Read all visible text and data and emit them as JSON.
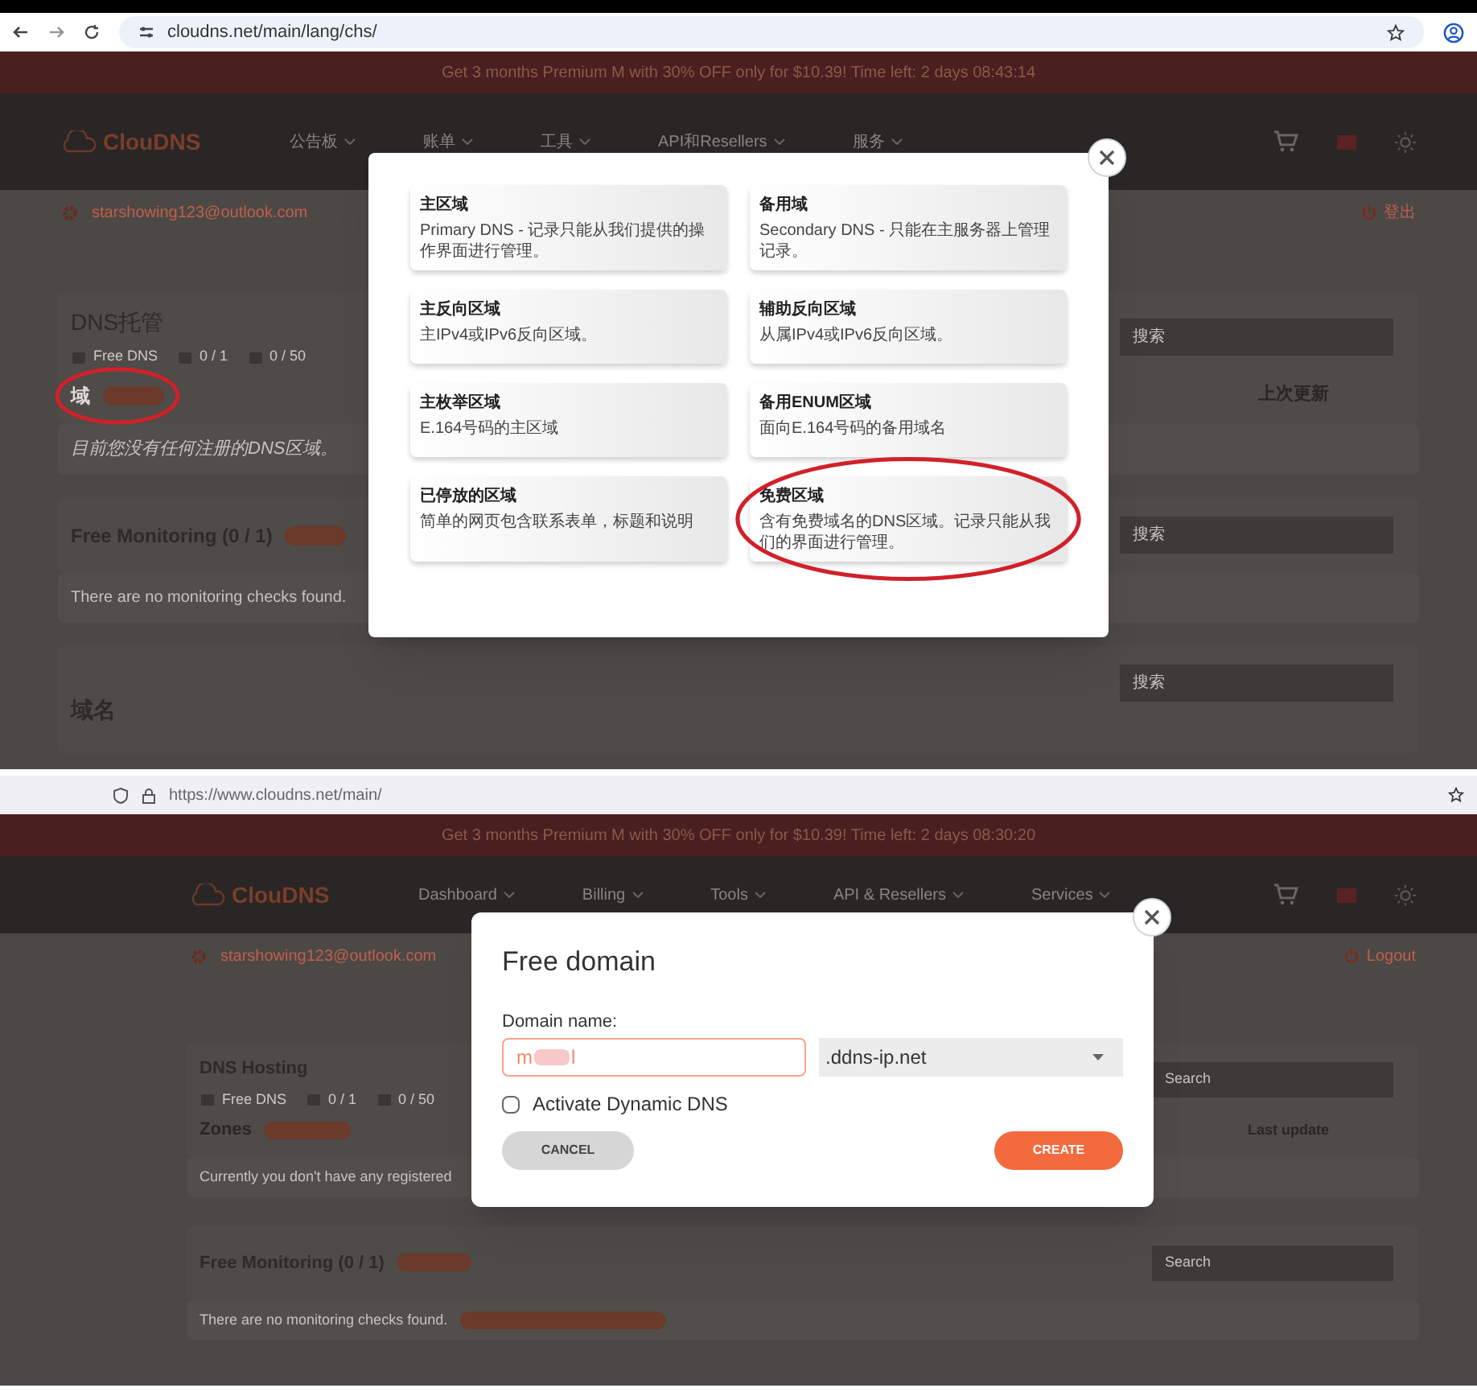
{
  "top": {
    "browser": {
      "url": "cloudns.net/main/lang/chs/"
    },
    "promo": "Get 3 months Premium M with 30% OFF only for $10.39! Time left: 2 days 08:43:14",
    "nav": {
      "logo": "ClouDNS",
      "items": [
        "公告板",
        "账单",
        "工具",
        "API和Resellers",
        "服务"
      ]
    },
    "user": {
      "email": "starshowing123@outlook.com",
      "logout": "登出"
    },
    "dns": {
      "title": "DNS托管",
      "stats": [
        "Free DNS",
        "0 / 1",
        "0 / 50"
      ],
      "zones_label": "域",
      "last_update": "上次更新",
      "search": "搜索",
      "empty": "目前您没有任何注册的DNS区域。"
    },
    "monitoring": {
      "title": "Free Monitoring (0 / 1)",
      "search": "搜索",
      "empty": "There are no monitoring checks found."
    },
    "domains": {
      "title": "域名",
      "search": "搜索"
    },
    "modal": {
      "cards": [
        {
          "title": "主区域",
          "description": "Primary DNS - 记录只能从我们提供的操作界面进行管理。",
          "circled": false
        },
        {
          "title": "备用域",
          "description": "Secondary DNS - 只能在主服务器上管理记录。",
          "circled": false
        },
        {
          "title": "主反向区域",
          "description": "主IPv4或IPv6反向区域。",
          "circled": false
        },
        {
          "title": "辅助反向区域",
          "description": "从属IPv4或IPv6反向区域。",
          "circled": false
        },
        {
          "title": "主枚举区域",
          "description": "E.164号码的主区域",
          "circled": false
        },
        {
          "title": "备用ENUM区域",
          "description": "面向E.164号码的备用域名",
          "circled": false
        },
        {
          "title": "已停放的区域",
          "description": "简单的网页包含联系表单，标题和说明",
          "circled": false
        },
        {
          "title": "免费区域",
          "description": "含有免费域名的DNS区域。记录只能从我们的界面进行管理。",
          "circled": true
        }
      ]
    }
  },
  "bottom": {
    "browser": {
      "url": "https://www.cloudns.net/main/"
    },
    "promo": "Get 3 months Premium M with 30% OFF only for $10.39! Time left: 2 days 08:30:20",
    "nav": {
      "logo": "ClouDNS",
      "items": [
        "Dashboard",
        "Billing",
        "Tools",
        "API & Resellers",
        "Services"
      ]
    },
    "user": {
      "email": "starshowing123@outlook.com",
      "logout": "Logout"
    },
    "dns": {
      "title": "DNS Hosting",
      "stats": [
        "Free DNS",
        "0 / 1",
        "0 / 50"
      ],
      "zones_label": "Zones",
      "last_update": "Last update",
      "search": "Search",
      "empty": "Currently you don't have any registered"
    },
    "monitoring": {
      "title": "Free Monitoring (0 / 1)",
      "search": "Search",
      "empty": "There are no monitoring checks found."
    },
    "modal": {
      "title": "Free domain",
      "label": "Domain name:",
      "value_parts": [
        "m",
        "l"
      ],
      "suffix": ".ddns-ip.net",
      "checkbox": {
        "label": "Activate Dynamic DNS",
        "checked": false
      },
      "cancel": "CANCEL",
      "create": "CREATE"
    }
  }
}
